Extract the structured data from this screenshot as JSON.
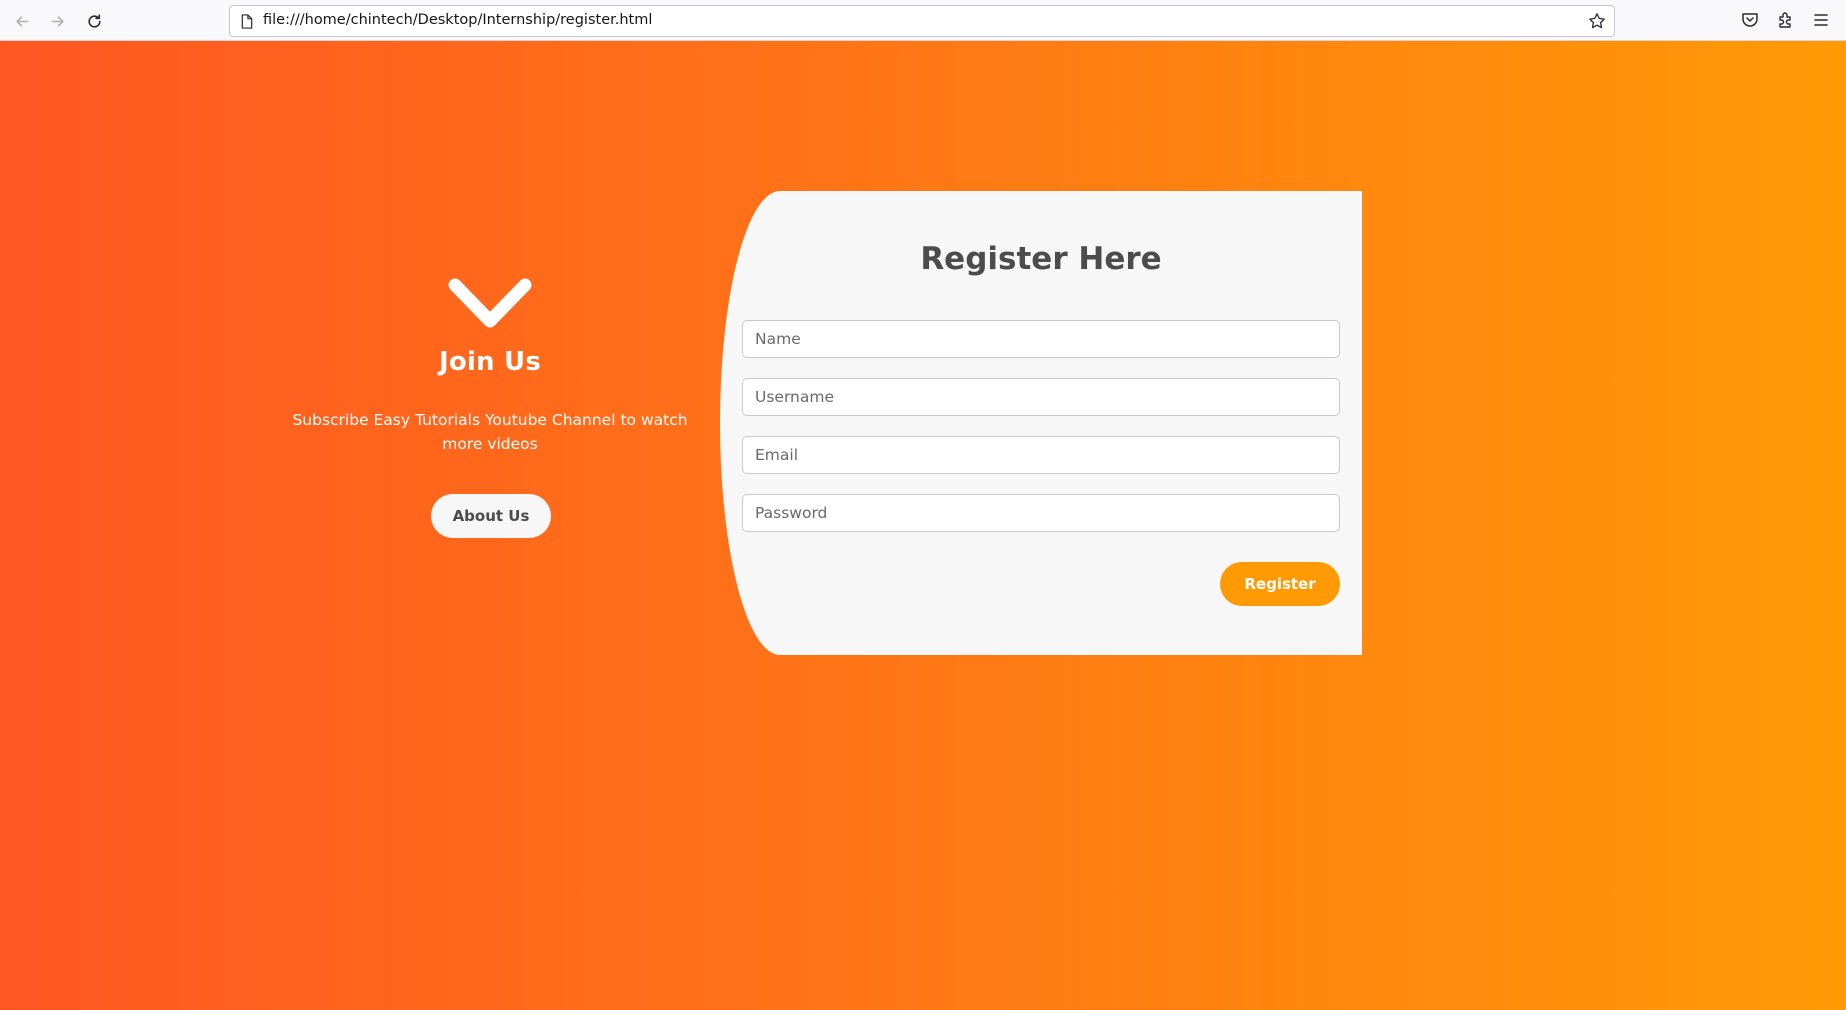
{
  "browser": {
    "url": "file:///home/chintech/Desktop/Internship/register.html",
    "icons": {
      "back": "arrow-left-icon",
      "forward": "arrow-right-icon",
      "reload": "reload-icon",
      "page": "page-icon",
      "bookmark": "star-icon",
      "pocket": "pocket-icon",
      "extensions": "puzzle-icon",
      "menu": "hamburger-menu-icon"
    }
  },
  "left_panel": {
    "icon": "chevron-check-icon",
    "title": "Join Us",
    "text": "Subscribe Easy Tutorials Youtube Channel to watch more videos",
    "button_label": "About Us"
  },
  "form": {
    "title": "Register Here",
    "fields": [
      {
        "placeholder": "Name",
        "value": ""
      },
      {
        "placeholder": "Username",
        "value": ""
      },
      {
        "placeholder": "Email",
        "value": ""
      },
      {
        "placeholder": "Password",
        "value": ""
      }
    ],
    "submit_label": "Register"
  },
  "colors": {
    "gradient_start": "#ff5722",
    "gradient_end": "#ff9a05",
    "card_background": "#f7f7f7",
    "register_button": "#ff9a05",
    "heading_text": "#4c4c4c"
  }
}
